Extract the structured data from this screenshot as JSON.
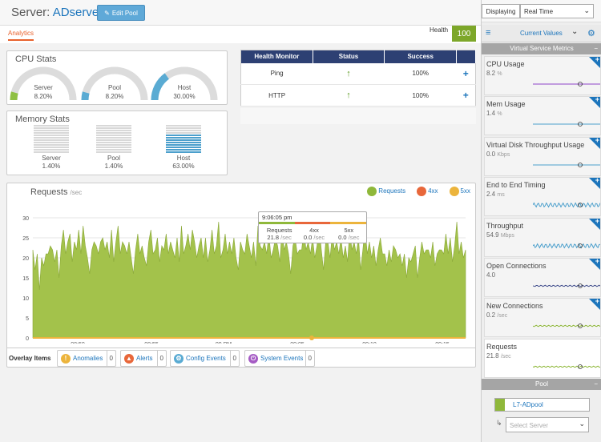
{
  "header": {
    "title_prefix": "Server: ",
    "title_name": "ADserver",
    "edit_label": "Edit Pool"
  },
  "tabs": {
    "analytics": "Analytics"
  },
  "health": {
    "label": "Health",
    "score": "100"
  },
  "cpu": {
    "title": "CPU Stats",
    "gauges": [
      {
        "label": "Server",
        "value": "8.20%",
        "fraction": 0.082,
        "color": "#8fc043"
      },
      {
        "label": "Pool",
        "value": "8.20%",
        "fraction": 0.082,
        "color": "#5aabd3"
      },
      {
        "label": "Host",
        "value": "30.00%",
        "fraction": 0.3,
        "color": "#5aabd3"
      }
    ]
  },
  "memory": {
    "title": "Memory Stats",
    "cols": [
      {
        "label": "Server",
        "value": "1.40%",
        "fraction": 0.014
      },
      {
        "label": "Pool",
        "value": "1.40%",
        "fraction": 0.014
      },
      {
        "label": "Host",
        "value": "63.00%",
        "fraction": 0.63
      }
    ]
  },
  "health_monitor": {
    "headers": [
      "Health Monitor",
      "Status",
      "Success",
      ""
    ],
    "rows": [
      {
        "name": "Ping",
        "success": "100%"
      },
      {
        "name": "HTTP",
        "success": "100%"
      }
    ]
  },
  "requests": {
    "title": "Requests",
    "unit": "/sec",
    "legend": [
      {
        "label": "Requests",
        "color": "#8fb83a"
      },
      {
        "label": "4xx",
        "color": "#e8673a"
      },
      {
        "label": "5xx",
        "color": "#ecb43c"
      }
    ],
    "tooltip": {
      "time": "9:06:05 pm",
      "cols": [
        {
          "label": "Requests",
          "value": "21.8",
          "unit": "/sec"
        },
        {
          "label": "4xx",
          "value": "0.0",
          "unit": "/sec"
        },
        {
          "label": "5xx",
          "value": "0.0",
          "unit": "/sec"
        }
      ]
    }
  },
  "chart_data": {
    "type": "area",
    "title": "Requests",
    "ylabel": "/sec",
    "ylim": [
      0,
      32
    ],
    "yticks": [
      "0",
      "5",
      "10",
      "15",
      "20",
      "25",
      "30"
    ],
    "xticks": [
      "08:50",
      "08:55",
      "09 PM",
      "09:05",
      "09:10",
      "09:15"
    ],
    "series": [
      {
        "name": "Requests",
        "color": "#a3c24b",
        "values": [
          22,
          17,
          21,
          12,
          20,
          18,
          21,
          21,
          23,
          22,
          19,
          22,
          15,
          23,
          27,
          21,
          24,
          26,
          19,
          24,
          22,
          27,
          21,
          28,
          23,
          20,
          16,
          22,
          24,
          23,
          21,
          24,
          25,
          22,
          24,
          20,
          27,
          19,
          24,
          28,
          21,
          24,
          23,
          21,
          24,
          20,
          16,
          22,
          26,
          21,
          23,
          20,
          18,
          24,
          27,
          21,
          22,
          25,
          19,
          23,
          22,
          26,
          21,
          24,
          22,
          20,
          25,
          19,
          28,
          21,
          23,
          26,
          22,
          27,
          24,
          20,
          23,
          25,
          20,
          25,
          19,
          22,
          27,
          21,
          23,
          29,
          20,
          22,
          26,
          21,
          24,
          21,
          25,
          20,
          17,
          24,
          22,
          21,
          26,
          23,
          20,
          24,
          18,
          28,
          23,
          22,
          24,
          21,
          26,
          20,
          22,
          25,
          23,
          19,
          27,
          22,
          24,
          21,
          16,
          23,
          25,
          21,
          22,
          22,
          27,
          22,
          24,
          21,
          25,
          20,
          23,
          28,
          22,
          17,
          24,
          24,
          20,
          26,
          22,
          24,
          21,
          25,
          20,
          23,
          19,
          27,
          22,
          24,
          21,
          25,
          17,
          22,
          28,
          21,
          24,
          20,
          23,
          18,
          22,
          25,
          21,
          21,
          18,
          22,
          19,
          23,
          22,
          20,
          21,
          18,
          21,
          15,
          20,
          19,
          21,
          23,
          15,
          20,
          24,
          21,
          22,
          22,
          20,
          24,
          18,
          21,
          22,
          22,
          21,
          26,
          21,
          25,
          19,
          23,
          29,
          21,
          24,
          20,
          22
        ]
      },
      {
        "name": "4xx",
        "color": "#e8673a",
        "values": [
          0
        ]
      },
      {
        "name": "5xx",
        "color": "#ecb43c",
        "values": [
          0
        ]
      }
    ]
  },
  "overlay": {
    "label": "Overlay Items",
    "items": [
      {
        "label": "Anomalies",
        "count": "0",
        "color": "#ecb43c",
        "icon": "!"
      },
      {
        "label": "Alerts",
        "count": "0",
        "color": "#e8673a",
        "icon": "▲"
      },
      {
        "label": "Config Events",
        "count": "0",
        "color": "#5aabd3",
        "icon": "⚙"
      },
      {
        "label": "System Events",
        "count": "0",
        "color": "#a55bc4",
        "icon": "⏻"
      }
    ]
  },
  "sidebar": {
    "displaying_label": "Displaying",
    "displaying_value": "Real Time",
    "current_values": "Current Values",
    "metrics_header": "Virtual Service Metrics",
    "metrics": [
      {
        "name": "CPU Usage",
        "value": "8.2",
        "unit": "%",
        "color": "#8e44c7"
      },
      {
        "name": "Mem Usage",
        "value": "1.4",
        "unit": "%",
        "color": "#4b9fcc"
      },
      {
        "name": "Virtual Disk Throughput Usage",
        "value": "0.0",
        "unit": "Kbps",
        "color": "#4b9fcc"
      },
      {
        "name": "End to End Timing",
        "value": "2.4",
        "unit": "ms",
        "color": "#4b9fcc"
      },
      {
        "name": "Throughput",
        "value": "54.9",
        "unit": "Mbps",
        "color": "#4b9fcc"
      },
      {
        "name": "Open Connections",
        "value": "4.0",
        "unit": "",
        "color": "#3d4a8a"
      },
      {
        "name": "New Connections",
        "value": "0.2",
        "unit": "/sec",
        "color": "#8fb83a"
      },
      {
        "name": "Requests",
        "value": "21.8",
        "unit": "/sec",
        "color": "#8fb83a"
      }
    ],
    "pool_header": "Pool",
    "pool_name": "L7-ADpool",
    "select_server_placeholder": "Select Server"
  }
}
